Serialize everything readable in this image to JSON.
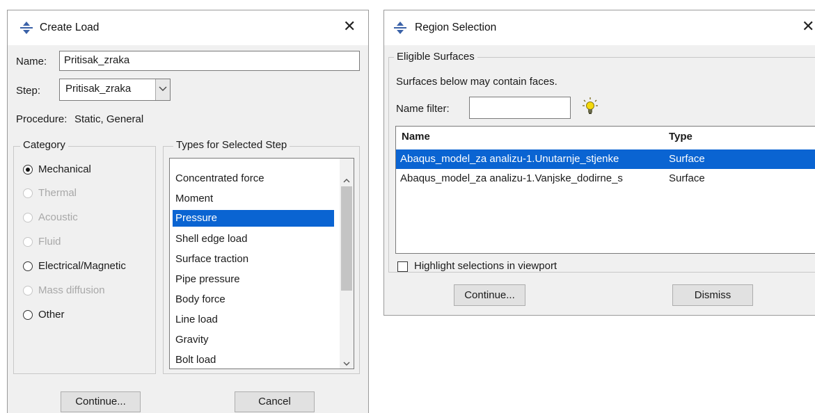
{
  "create_load": {
    "title": "Create Load",
    "name_label": "Name:",
    "name_value": "Pritisak_zraka",
    "step_label": "Step:",
    "step_value": "Pritisak_zraka",
    "procedure_label": "Procedure:",
    "procedure_value": "Static, General",
    "category_title": "Category",
    "categories": [
      {
        "label": "Mechanical",
        "selected": true,
        "enabled": true
      },
      {
        "label": "Thermal",
        "selected": false,
        "enabled": false
      },
      {
        "label": "Acoustic",
        "selected": false,
        "enabled": false
      },
      {
        "label": "Fluid",
        "selected": false,
        "enabled": false
      },
      {
        "label": "Electrical/Magnetic",
        "selected": false,
        "enabled": true
      },
      {
        "label": "Mass diffusion",
        "selected": false,
        "enabled": false
      },
      {
        "label": "Other",
        "selected": false,
        "enabled": true
      }
    ],
    "types_title": "Types for Selected Step",
    "types": [
      "Concentrated force",
      "Moment",
      "Pressure",
      "Shell edge load",
      "Surface traction",
      "Pipe pressure",
      "Body force",
      "Line load",
      "Gravity",
      "Bolt load"
    ],
    "selected_type": "Pressure",
    "continue_label": "Continue...",
    "cancel_label": "Cancel"
  },
  "region_selection": {
    "title": "Region Selection",
    "group_title": "Eligible Surfaces",
    "note": "Surfaces below may contain faces.",
    "filter_label": "Name filter:",
    "filter_value": "",
    "columns": [
      "Name",
      "Type"
    ],
    "rows": [
      {
        "name": "Abaqus_model_za analizu-1.Unutarnje_stjenke",
        "type": "Surface",
        "selected": true
      },
      {
        "name": "Abaqus_model_za analizu-1.Vanjske_dodirne_s",
        "type": "Surface",
        "selected": false
      }
    ],
    "highlight_label": "Highlight selections in viewport",
    "highlight_checked": false,
    "continue_label": "Continue...",
    "dismiss_label": "Dismiss"
  },
  "colors": {
    "selection": "#0a64d2",
    "dialog_bg": "#f0f0f0",
    "icon_blue": "#3b62a8",
    "bulb_yellow": "#f5d90a"
  },
  "icons": {
    "app_icon": "abaqus-arrows-icon",
    "close": "close-icon",
    "bulb": "lightbulb-icon",
    "dropdown": "chevron-down-icon"
  }
}
